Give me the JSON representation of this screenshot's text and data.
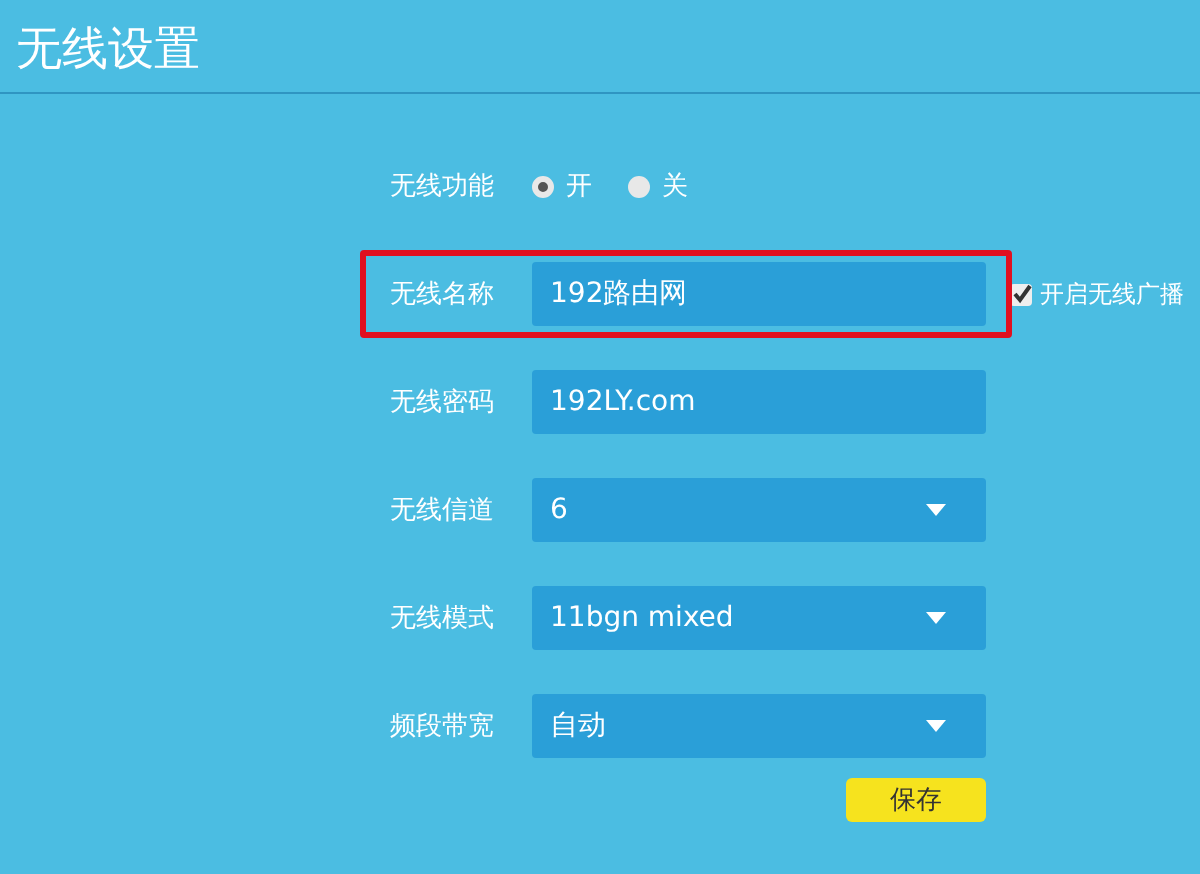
{
  "title": "无线设置",
  "wireless_toggle": {
    "label": "无线功能",
    "options": [
      {
        "label": "开",
        "selected": true
      },
      {
        "label": "关",
        "selected": false
      }
    ]
  },
  "fields": [
    {
      "label": "无线名称",
      "kind": "text",
      "value": "192路由网",
      "highlighted": true,
      "extra": {
        "label": "开启无线广播",
        "checked": true
      }
    },
    {
      "label": "无线密码",
      "kind": "text",
      "value": "192LY.com",
      "highlighted": false
    },
    {
      "label": "无线信道",
      "kind": "select",
      "value": "6",
      "highlighted": false
    },
    {
      "label": "无线模式",
      "kind": "select",
      "value": "11bgn mixed",
      "highlighted": false
    },
    {
      "label": "频段带宽",
      "kind": "select",
      "value": "自动",
      "highlighted": false
    }
  ],
  "save_button": "保存"
}
